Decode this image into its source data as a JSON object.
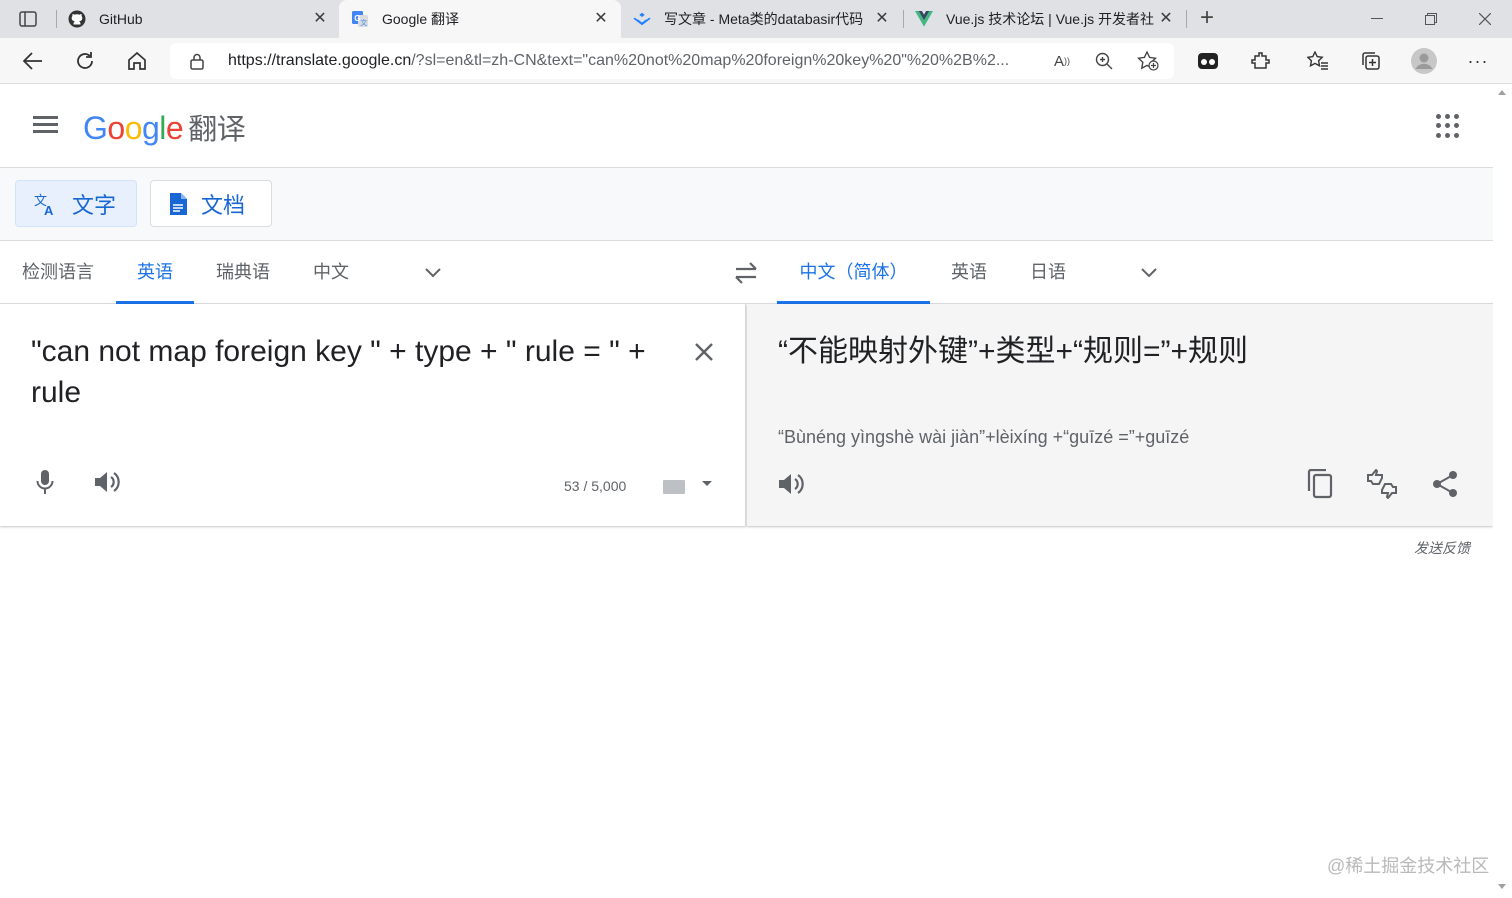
{
  "browser": {
    "tabs": [
      {
        "title": "GitHub",
        "icon": "github-icon"
      },
      {
        "title": "Google 翻译",
        "icon": "google-translate-icon",
        "active": true
      },
      {
        "title": "写文章 - Meta类的databasir代码",
        "icon": "juejin-icon"
      },
      {
        "title": "Vue.js 技术论坛 | Vue.js 开发者社",
        "icon": "vue-icon"
      }
    ],
    "new_tab": "+",
    "url_domain": "https://translate.google.cn",
    "url_rest": "/?sl=en&tl=zh-CN&text=\"can%20not%20map%20foreign%20key%20\"%20%2B%2..."
  },
  "header": {
    "logo": {
      "g": "G",
      "o1": "o",
      "o2": "o",
      "g2": "g",
      "l": "l",
      "e": "e"
    },
    "product": "翻译"
  },
  "modes": {
    "text": "文字",
    "docs": "文档"
  },
  "source_langs": [
    "检测语言",
    "英语",
    "瑞典语",
    "中文"
  ],
  "target_langs": [
    "中文（简体）",
    "英语",
    "日语"
  ],
  "source": {
    "text": "\"can not map foreign key \" + type + \" rule = \" + rule",
    "char_count": "53 / 5,000"
  },
  "target": {
    "text": "“不能映射外键”+类型+“规则=”+规则",
    "transliteration": "“Bùnéng yìngshè wài jiàn”+lèixíng +“guīzé =”+guīzé"
  },
  "feedback": "发送反馈",
  "watermark": "@稀土掘金技术社区",
  "colors": {
    "accent": "#1a73e8",
    "text": "#202124",
    "secondary": "#5f6368"
  }
}
